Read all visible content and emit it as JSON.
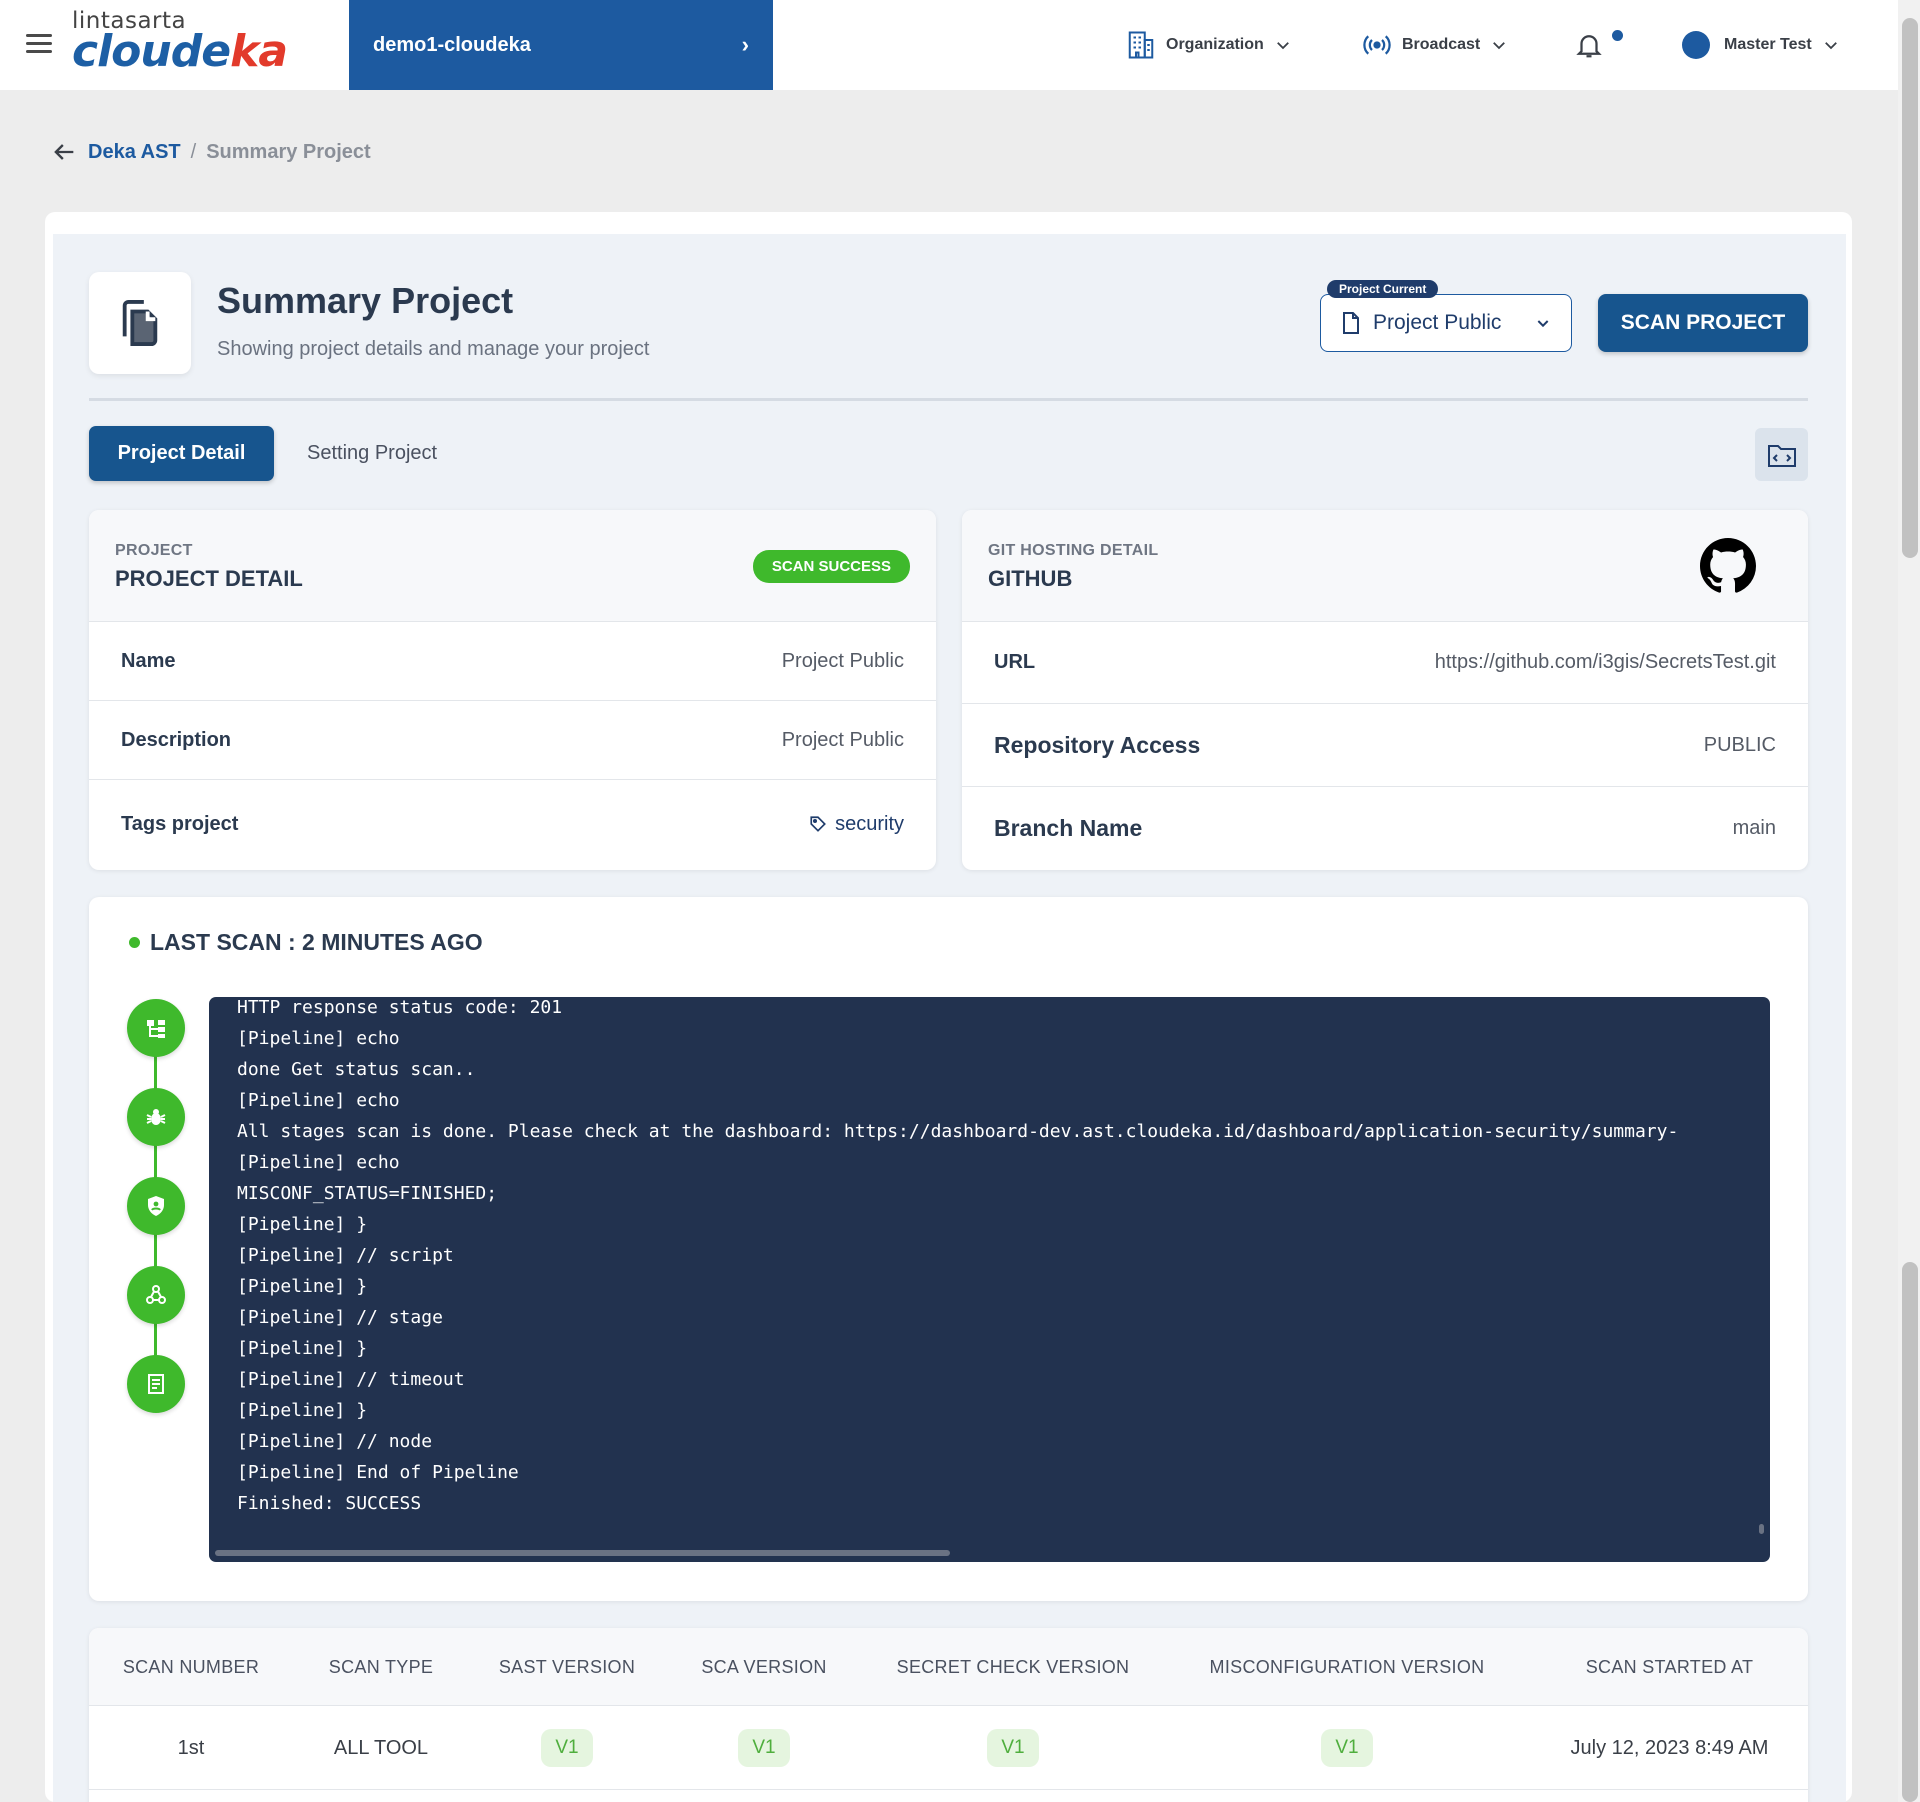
{
  "header": {
    "logo_small": "lintasarta",
    "logo_main_a": "cloude",
    "logo_main_b": "ka",
    "workspace": "demo1-cloudeka",
    "organization_label": "Organization",
    "broadcast_label": "Broadcast",
    "user_name": "Master Test",
    "accent": "#1d5aa0"
  },
  "breadcrumb": {
    "parent": "Deka AST",
    "separator": "/",
    "current": "Summary Project"
  },
  "page": {
    "title": "Summary Project",
    "subtitle": "Showing project details and manage your project",
    "project_current_badge": "Project Current",
    "project_current_value": "Project Public",
    "scan_button": "SCAN PROJECT"
  },
  "tabs": [
    {
      "label": "Project Detail",
      "active": true
    },
    {
      "label": "Setting Project",
      "active": false
    }
  ],
  "project_detail": {
    "kicker": "PROJECT",
    "title": "PROJECT DETAIL",
    "status": "SCAN SUCCESS",
    "status_color": "#3fb92c",
    "rows": [
      {
        "key": "Name",
        "value": "Project Public"
      },
      {
        "key": "Description",
        "value": "Project Public"
      },
      {
        "key": "Tags project",
        "value": "security"
      }
    ]
  },
  "git_detail": {
    "kicker": "GIT HOSTING DETAIL",
    "title": "GITHUB",
    "icon": "github-icon",
    "rows": [
      {
        "key": "URL",
        "value": "https://github.com/i3gis/SecretsTest.git"
      },
      {
        "key": "Repository Access",
        "value": "PUBLIC"
      },
      {
        "key": "Branch Name",
        "value": "main"
      }
    ]
  },
  "last_scan": {
    "label": "LAST SCAN : 2 MINUTES AGO",
    "steps": [
      "sitemap-icon",
      "bug-icon",
      "shield-icon",
      "webhook-icon",
      "checklist-icon"
    ],
    "console_lines": [
      "HTTP response status code: 201",
      "[Pipeline] echo",
      "done Get status scan..",
      "[Pipeline] echo",
      "All stages scan is done. Please check at the dashboard: https://dashboard-dev.ast.cloudeka.id/dashboard/application-security/summary-",
      "[Pipeline] echo",
      "MISCONF_STATUS=FINISHED;",
      "[Pipeline] }",
      "[Pipeline] // script",
      "[Pipeline] }",
      "[Pipeline] // stage",
      "[Pipeline] }",
      "[Pipeline] // timeout",
      "[Pipeline] }",
      "[Pipeline] // node",
      "[Pipeline] End of Pipeline",
      "Finished: SUCCESS"
    ]
  },
  "scan_table": {
    "columns": [
      "SCAN NUMBER",
      "SCAN TYPE",
      "SAST VERSION",
      "SCA VERSION",
      "SECRET CHECK VERSION",
      "MISCONFIGURATION VERSION",
      "SCAN STARTED AT"
    ],
    "rows": [
      [
        "1st",
        "ALL TOOL",
        "V1",
        "V1",
        "V1",
        "V1",
        "July 12, 2023 8:49 AM"
      ]
    ]
  }
}
